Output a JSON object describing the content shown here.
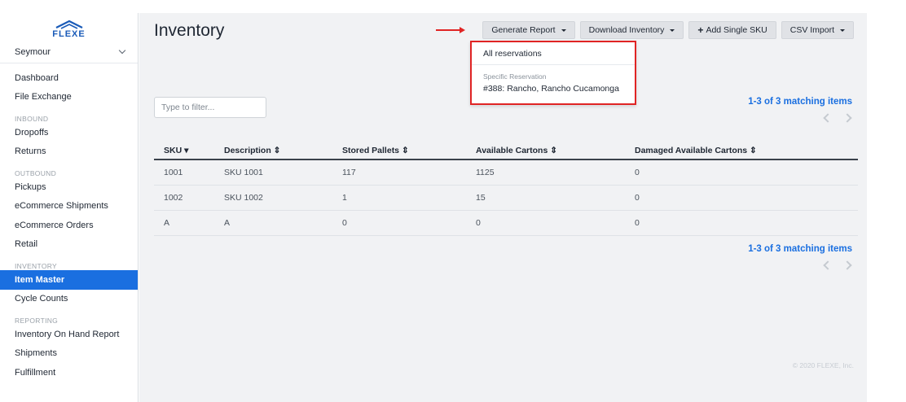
{
  "brand": {
    "name": "FLEXE"
  },
  "sidebar": {
    "account": "Seymour",
    "items": [
      {
        "type": "item",
        "label": "Dashboard"
      },
      {
        "type": "item",
        "label": "File Exchange"
      },
      {
        "type": "section",
        "label": "INBOUND"
      },
      {
        "type": "item",
        "label": "Dropoffs"
      },
      {
        "type": "item",
        "label": "Returns"
      },
      {
        "type": "section",
        "label": "OUTBOUND"
      },
      {
        "type": "item",
        "label": "Pickups"
      },
      {
        "type": "item",
        "label": "eCommerce Shipments"
      },
      {
        "type": "item",
        "label": "eCommerce Orders"
      },
      {
        "type": "item",
        "label": "Retail"
      },
      {
        "type": "section",
        "label": "INVENTORY"
      },
      {
        "type": "item",
        "label": "Item Master",
        "active": true
      },
      {
        "type": "item",
        "label": "Cycle Counts"
      },
      {
        "type": "section",
        "label": "REPORTING"
      },
      {
        "type": "item",
        "label": "Inventory On Hand Report"
      },
      {
        "type": "item",
        "label": "Shipments"
      },
      {
        "type": "item",
        "label": "Fulfillment"
      }
    ]
  },
  "main": {
    "title": "Inventory",
    "toolbar": {
      "generate_report": "Generate Report",
      "download_inventory": "Download Inventory",
      "add_single_sku": "Add Single SKU",
      "csv_import": "CSV Import"
    },
    "dropdown": {
      "all_reservations": "All reservations",
      "specific_header": "Specific Reservation",
      "reservation": "#388: Rancho, Rancho Cucamonga"
    },
    "filter_placeholder": "Type to filter...",
    "matching_top": "1-3 of 3 matching items",
    "matching_bottom": "1-3 of 3 matching items",
    "table": {
      "headers": [
        "SKU",
        "Description",
        "Stored Pallets",
        "Available Cartons",
        "Damaged Available Cartons"
      ],
      "rows": [
        [
          "1001",
          "SKU 1001",
          "117",
          "1125",
          "0"
        ],
        [
          "1002",
          "SKU 1002",
          "1",
          "15",
          "0"
        ],
        [
          "A",
          "A",
          "0",
          "0",
          "0"
        ]
      ]
    },
    "footer": "© 2020 FLEXE, Inc."
  },
  "colors": {
    "accent": "#1a6fe0",
    "highlight": "#e02424"
  }
}
